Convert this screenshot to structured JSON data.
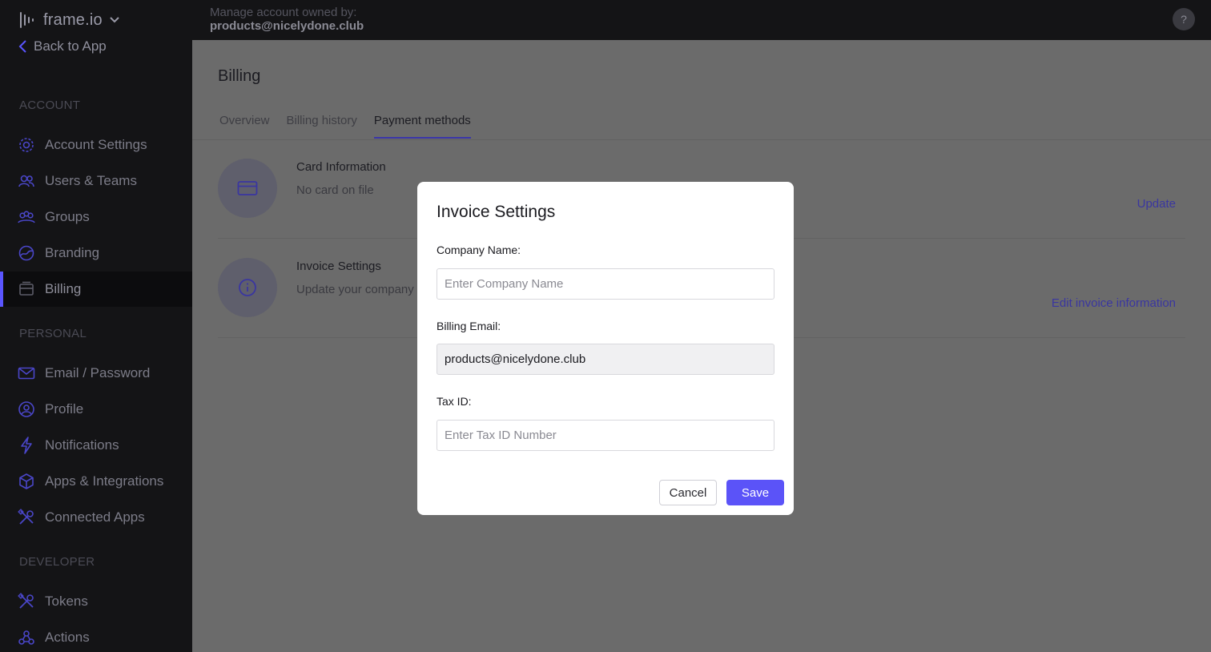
{
  "app": {
    "logo_text": "frame.io",
    "back_label": "Back to App"
  },
  "topbar": {
    "owned_label": "Manage account owned by:",
    "owned_email": "products@nicelydone.club",
    "help_label": "?"
  },
  "sidebar": {
    "sections": {
      "account": "ACCOUNT",
      "personal": "PERSONAL",
      "developer": "DEVELOPER"
    },
    "items": [
      {
        "label": "Account Settings",
        "icon": "gear-icon"
      },
      {
        "label": "Users & Teams",
        "icon": "users-icon"
      },
      {
        "label": "Groups",
        "icon": "groups-icon"
      },
      {
        "label": "Branding",
        "icon": "palette-icon"
      },
      {
        "label": "Billing",
        "icon": "billing-icon",
        "active": true
      },
      {
        "label": "Email / Password",
        "icon": "envelope-icon"
      },
      {
        "label": "Profile",
        "icon": "profile-icon"
      },
      {
        "label": "Notifications",
        "icon": "bolt-icon"
      },
      {
        "label": "Apps & Integrations",
        "icon": "cube-icon"
      },
      {
        "label": "Connected Apps",
        "icon": "tools-icon"
      },
      {
        "label": "Tokens",
        "icon": "tools-icon"
      },
      {
        "label": "Actions",
        "icon": "webhook-icon"
      }
    ]
  },
  "main": {
    "title": "Billing",
    "tabs": [
      {
        "label": "Overview"
      },
      {
        "label": "Billing history"
      },
      {
        "label": "Payment methods",
        "active": true
      }
    ],
    "rows": [
      {
        "title": "Card Information",
        "subtitle": "No card on file",
        "action": "Update",
        "icon": "credit-card-icon"
      },
      {
        "title": "Invoice Settings",
        "subtitle": "Update your company name",
        "action": "Edit invoice information",
        "icon": "info-icon"
      }
    ]
  },
  "modal": {
    "title": "Invoice Settings",
    "company_label": "Company Name:",
    "company_placeholder": "Enter Company Name",
    "company_value": "",
    "email_label": "Billing Email:",
    "email_value": "products@nicelydone.club",
    "tax_label": "Tax ID:",
    "tax_placeholder": "Enter Tax ID Number",
    "tax_value": "",
    "cancel_label": "Cancel",
    "save_label": "Save"
  },
  "colors": {
    "accent": "#5b53f8",
    "sidebar_bg": "#141416",
    "overlay_bg": "#6b6b6b"
  }
}
